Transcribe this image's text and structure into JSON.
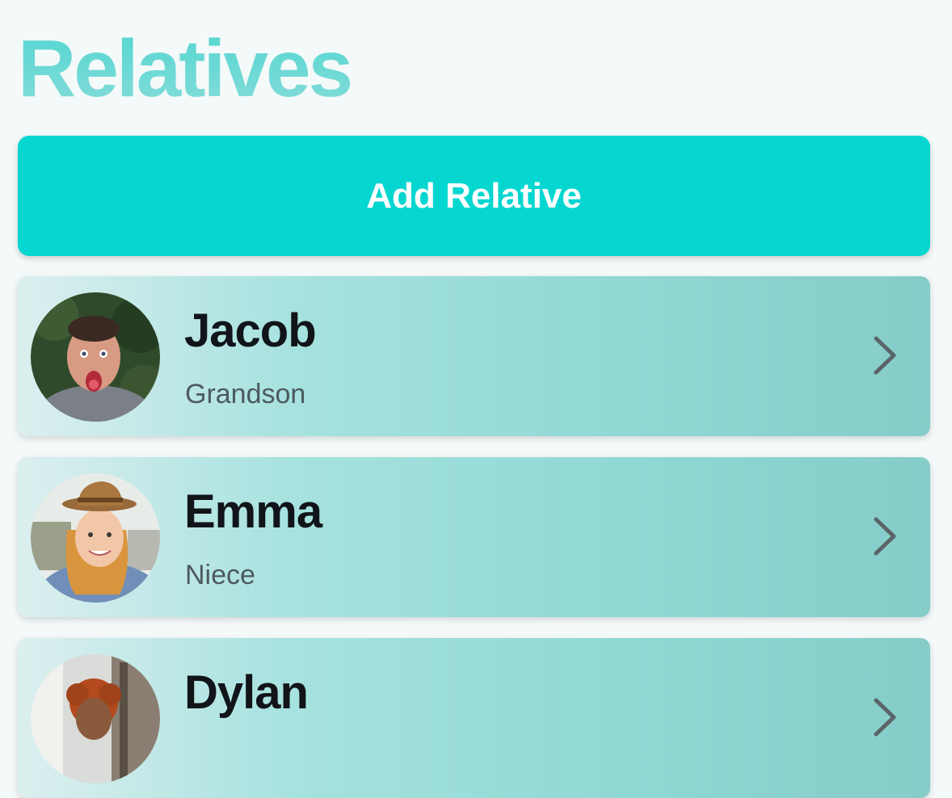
{
  "page": {
    "title": "Relatives"
  },
  "actions": {
    "add_label": "Add Relative"
  },
  "relatives": [
    {
      "name": "Jacob",
      "relation": "Grandson",
      "avatar": "photo-boy-surprised"
    },
    {
      "name": "Emma",
      "relation": "Niece",
      "avatar": "photo-girl-hat"
    },
    {
      "name": "Dylan",
      "relation": "",
      "avatar": "photo-person-curly-hair"
    }
  ],
  "colors": {
    "accent": "#05d6d0",
    "title": "#52d6d2",
    "card_start": "#dcefef",
    "card_end": "#86ccc9",
    "name_text": "#111418",
    "relation_text": "#4d5a5e",
    "chevron": "#5b6468"
  },
  "icons": {
    "row_arrow": "chevron-right-icon"
  }
}
